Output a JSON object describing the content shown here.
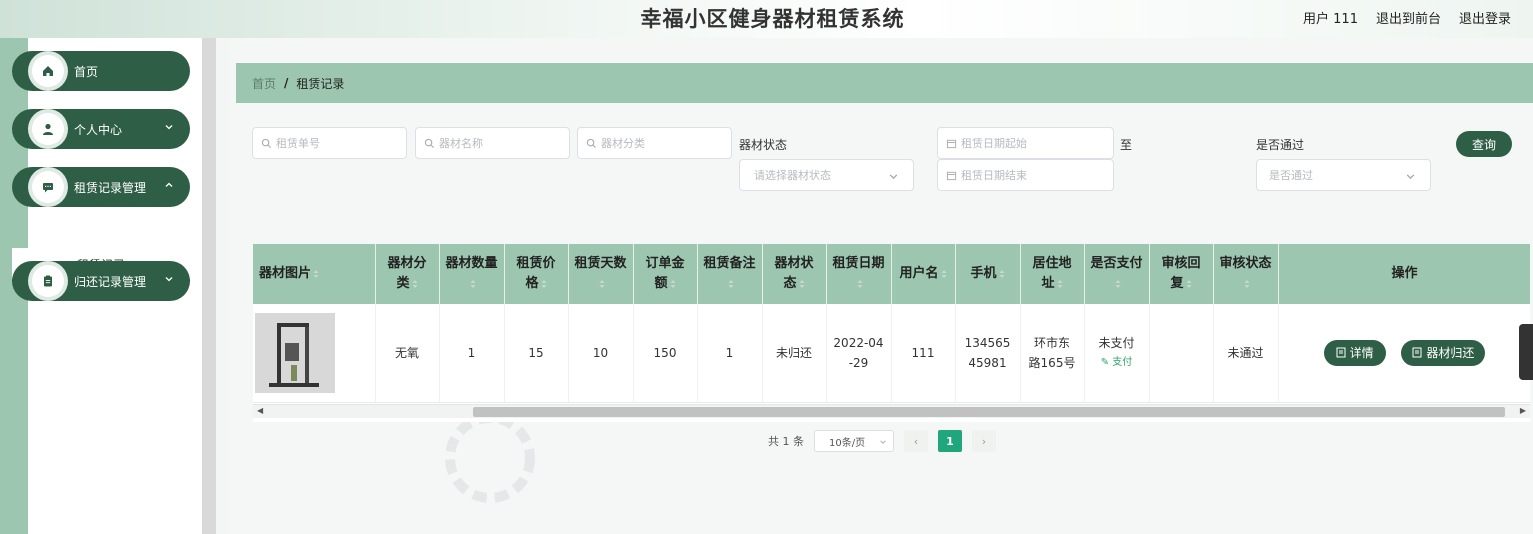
{
  "header": {
    "title": "幸福小区健身器材租赁系统",
    "user_label": "用户 111",
    "back_to_front": "退出到前台",
    "logout": "退出登录"
  },
  "sidebar": {
    "items": [
      {
        "label": "首页",
        "icon": "home-icon"
      },
      {
        "label": "个人中心",
        "icon": "user-icon"
      },
      {
        "label": "租赁记录管理",
        "icon": "chat-icon"
      },
      {
        "label": "归还记录管理",
        "icon": "clipboard-icon"
      }
    ],
    "sub_item": "租赁记录"
  },
  "breadcrumb": {
    "home": "首页",
    "separator": "/",
    "current": "租赁记录"
  },
  "filters": {
    "rental_no_placeholder": "租赁单号",
    "equip_name_placeholder": "器材名称",
    "equip_category_placeholder": "器材分类",
    "status_label": "器材状态",
    "status_placeholder": "请选择器材状态",
    "date_start_placeholder": "租赁日期起始",
    "date_to": "至",
    "date_end_placeholder": "租赁日期结束",
    "approved_label": "是否通过",
    "approved_placeholder": "是否通过",
    "query_button": "查询"
  },
  "table": {
    "headers": {
      "image": "器材图片",
      "category": "器材分类",
      "quantity": "器材数量",
      "price": "租赁价格",
      "days": "租赁天数",
      "amount": "订单金额",
      "remark": "租赁备注",
      "status": "器材状态",
      "date": "租赁日期",
      "username": "用户名",
      "phone": "手机",
      "address": "居住地址",
      "paid": "是否支付",
      "review_reply": "审核回复",
      "review_status": "审核状态",
      "actions": "操作"
    },
    "rows": [
      {
        "category": "无氧",
        "quantity": "1",
        "price": "15",
        "days": "10",
        "amount": "150",
        "remark": "1",
        "status": "未归还",
        "date": "2022-04-29",
        "username": "111",
        "phone": "13456545981",
        "address": "环市东路165号",
        "paid": "未支付",
        "pay_link": "支付",
        "review_reply": "",
        "review_status": "未通过",
        "detail_button": "详情",
        "return_button": "器材归还"
      }
    ]
  },
  "pagination": {
    "total": "共 1 条",
    "page_size": "10条/页",
    "current_page": "1",
    "prev": "‹",
    "next": "›"
  },
  "colors": {
    "primary": "#2f5e46",
    "header_green": "#9cc6b0",
    "active_page": "#1fa67a"
  }
}
